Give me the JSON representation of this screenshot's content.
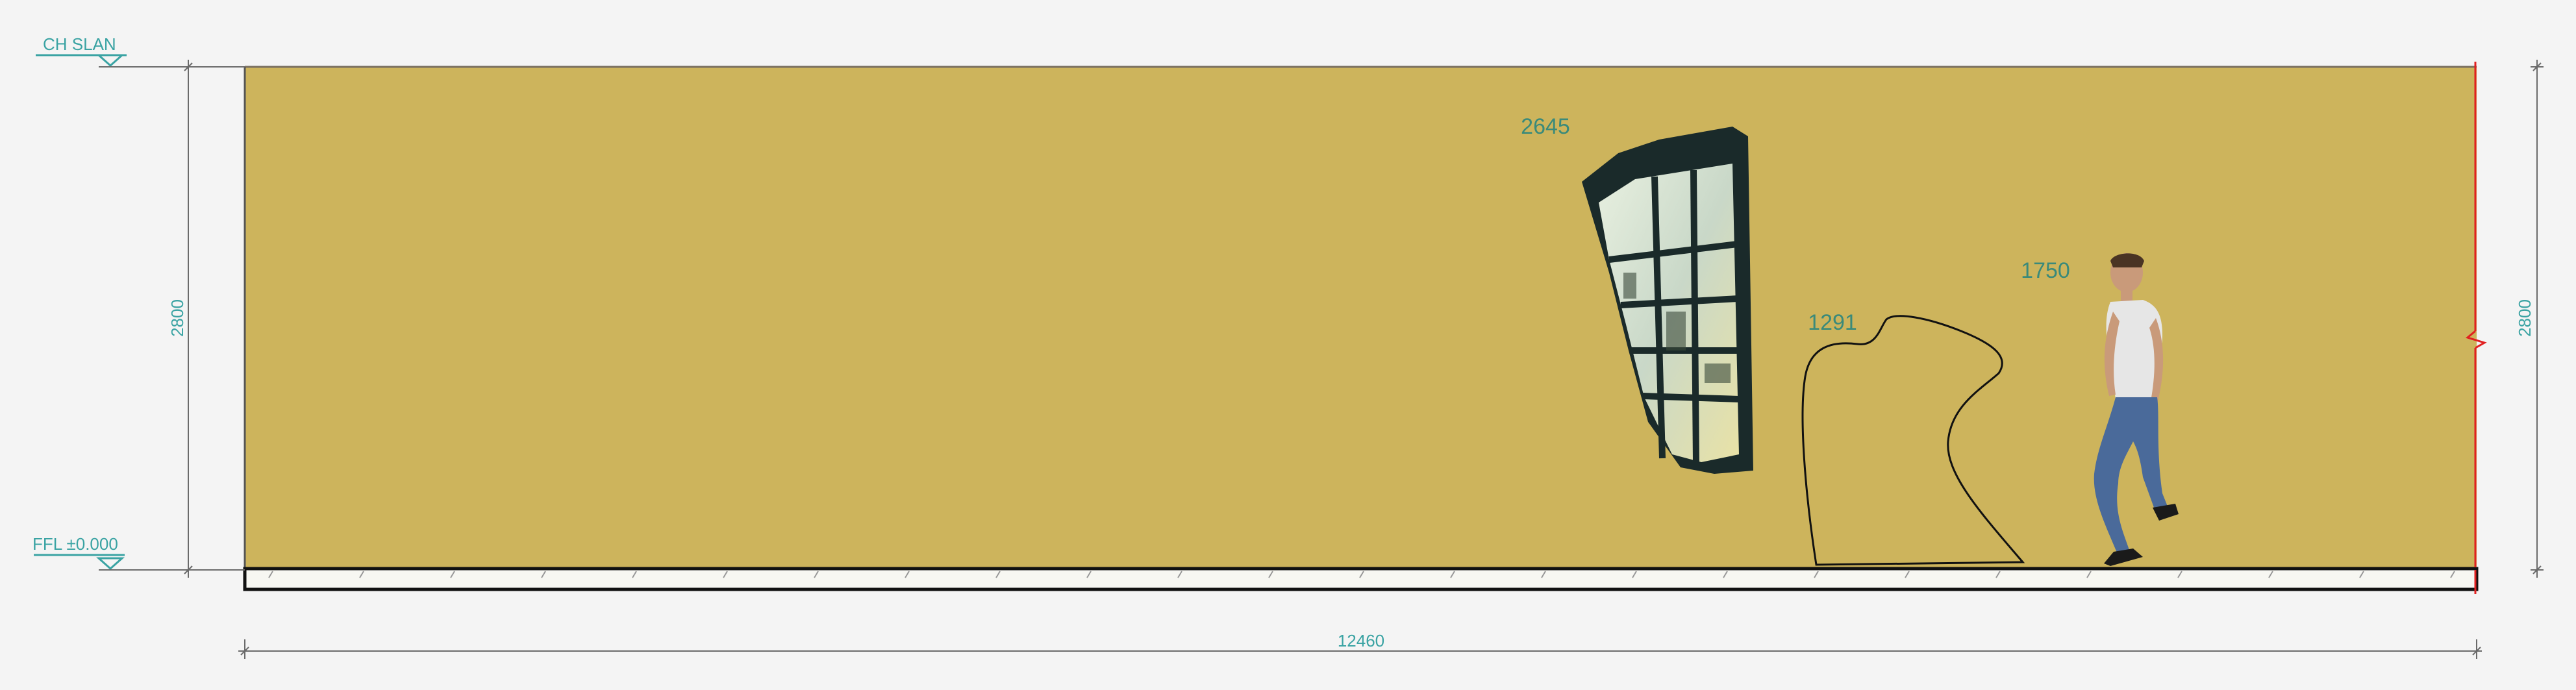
{
  "levels": {
    "top_label": "CH SLAN",
    "bottom_label": "FFL ±0.000"
  },
  "dimensions": {
    "height_left": "2800",
    "height_right": "2800",
    "total_length": "12460",
    "window_height": "2645",
    "sculpture_height": "1291",
    "person_height": "1750"
  },
  "colors": {
    "wall": "#cdb45c",
    "background": "#f4f4f4",
    "dimension_lines": "#6a6a6a",
    "annotation_text": "#3aa3a3",
    "cut_line": "#e02020"
  }
}
